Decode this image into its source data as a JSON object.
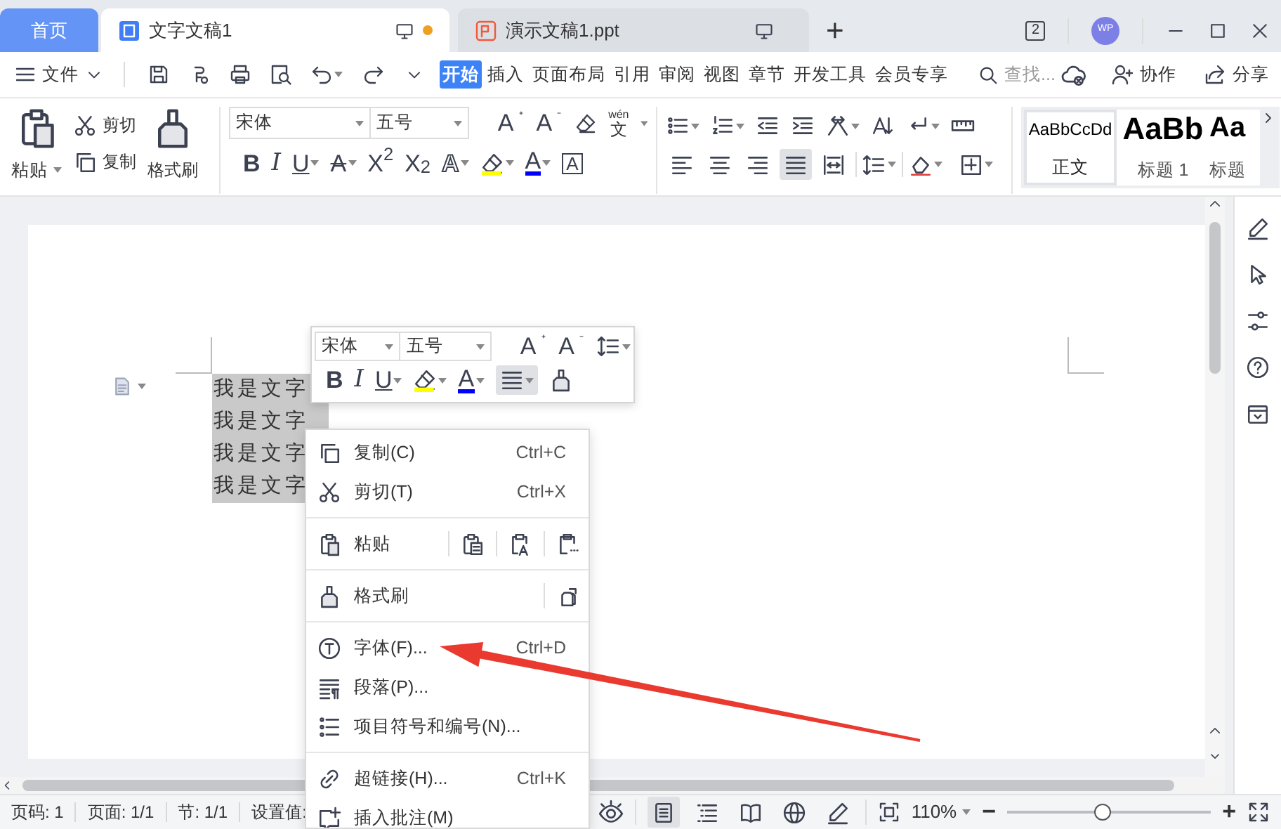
{
  "tabs": [
    {
      "kind": "home",
      "label": "首页",
      "selected": false
    },
    {
      "kind": "writer",
      "label": "文字文稿1",
      "selected": true,
      "unsaved": true
    },
    {
      "kind": "presentation",
      "label": "演示文稿1.ppt",
      "selected": false,
      "unsaved": false
    }
  ],
  "new_tab": "+",
  "window_count": "2",
  "avatar": "WP",
  "menu": {
    "file": "文件",
    "tabs": [
      {
        "label": "开始",
        "selected": true
      },
      {
        "label": "插入",
        "selected": false
      },
      {
        "label": "页面布局",
        "selected": false
      },
      {
        "label": "引用",
        "selected": false
      },
      {
        "label": "审阅",
        "selected": false
      },
      {
        "label": "视图",
        "selected": false
      },
      {
        "label": "章节",
        "selected": false
      },
      {
        "label": "开发工具",
        "selected": false
      },
      {
        "label": "会员专享",
        "selected": false
      }
    ],
    "search": {
      "placeholder": "查找..."
    },
    "collaborate": "协作",
    "share": "分享"
  },
  "ribbon": {
    "clipboard": {
      "paste": "粘贴",
      "cut": "剪切",
      "copy": "复制",
      "format_painter": "格式刷"
    },
    "font": {
      "name": "宋体",
      "size": "五号",
      "grow": "A",
      "shrink": "A",
      "pinyin": "wén",
      "pinyin_char": "文",
      "buttons": [
        {
          "kind": "bold",
          "glyph": "B"
        },
        {
          "kind": "italic",
          "glyph": "I"
        },
        {
          "kind": "underline",
          "glyph": "U"
        },
        {
          "kind": "emphasis",
          "glyph": "A"
        },
        {
          "kind": "superscript",
          "glyph": "X$^{2}$"
        },
        {
          "kind": "subscript",
          "glyph": "X$_{2}$"
        },
        {
          "kind": "effect",
          "glyph": "A"
        },
        {
          "kind": "highlight",
          "color": "#ffff00"
        },
        {
          "kind": "font_color",
          "glyph": "A",
          "color": "#0000ff"
        },
        {
          "kind": "border",
          "glyph": "A"
        }
      ]
    },
    "alignment": [
      {
        "selected": false
      },
      {
        "selected": false
      },
      {
        "selected": false
      },
      {
        "selected": true
      },
      {
        "selected": false
      }
    ],
    "styles": [
      {
        "kind": "normal",
        "sample": "AaBbCcDd",
        "name": "正文",
        "selected": true
      },
      {
        "kind": "heading1",
        "sample": "AaBb",
        "name": "标题 1",
        "selected": false
      },
      {
        "kind": "heading2",
        "sample": "Aa",
        "name": "标题",
        "selected": false
      }
    ]
  },
  "document": {
    "lines": [
      "我是文字",
      "我是文字",
      "我是文字",
      "我是文字"
    ],
    "selected": true
  },
  "mini_toolbar": {
    "font": "宋体",
    "size": "五号",
    "grow": "A",
    "shrink": "A",
    "buttons": [
      {
        "kind": "bold",
        "glyph": "B"
      },
      {
        "kind": "italic",
        "glyph": "I"
      },
      {
        "kind": "underline",
        "glyph": "U"
      },
      {
        "kind": "highlight",
        "color": "#ffff00"
      },
      {
        "kind": "font_color",
        "glyph": "A",
        "color": "#0000ff"
      },
      {
        "kind": "align",
        "selected": true
      },
      {
        "kind": "painter"
      }
    ]
  },
  "context_menu": [
    {
      "kind": "item",
      "label": "复制(C)",
      "shortcut": "Ctrl+C"
    },
    {
      "kind": "item",
      "label": "剪切(T)",
      "shortcut": "Ctrl+X"
    },
    {
      "kind": "separator"
    },
    {
      "kind": "paste",
      "label": "粘贴"
    },
    {
      "kind": "separator"
    },
    {
      "kind": "painter",
      "label": "格式刷"
    },
    {
      "kind": "separator"
    },
    {
      "kind": "item",
      "label": "字体(F)...",
      "shortcut": "Ctrl+D"
    },
    {
      "kind": "item",
      "label": "段落(P)..."
    },
    {
      "kind": "item",
      "label": "项目符号和编号(N)..."
    },
    {
      "kind": "separator"
    },
    {
      "kind": "item",
      "label": "超链接(H)...",
      "shortcut": "Ctrl+K"
    },
    {
      "kind": "item",
      "label": "插入批注(M)"
    }
  ],
  "status_bar": {
    "page_number": "页码: 1",
    "pages": "页面: 1/1",
    "section": "节: 1/1",
    "settings": "设置值:",
    "view_modes": [
      {
        "selected": true
      },
      {
        "selected": false
      },
      {
        "selected": false
      },
      {
        "selected": false
      },
      {
        "selected": false
      }
    ],
    "zoom": "110%",
    "zoom_out": "−",
    "zoom_slider": {
      "level": 0.47
    },
    "zoom_in": "+"
  }
}
